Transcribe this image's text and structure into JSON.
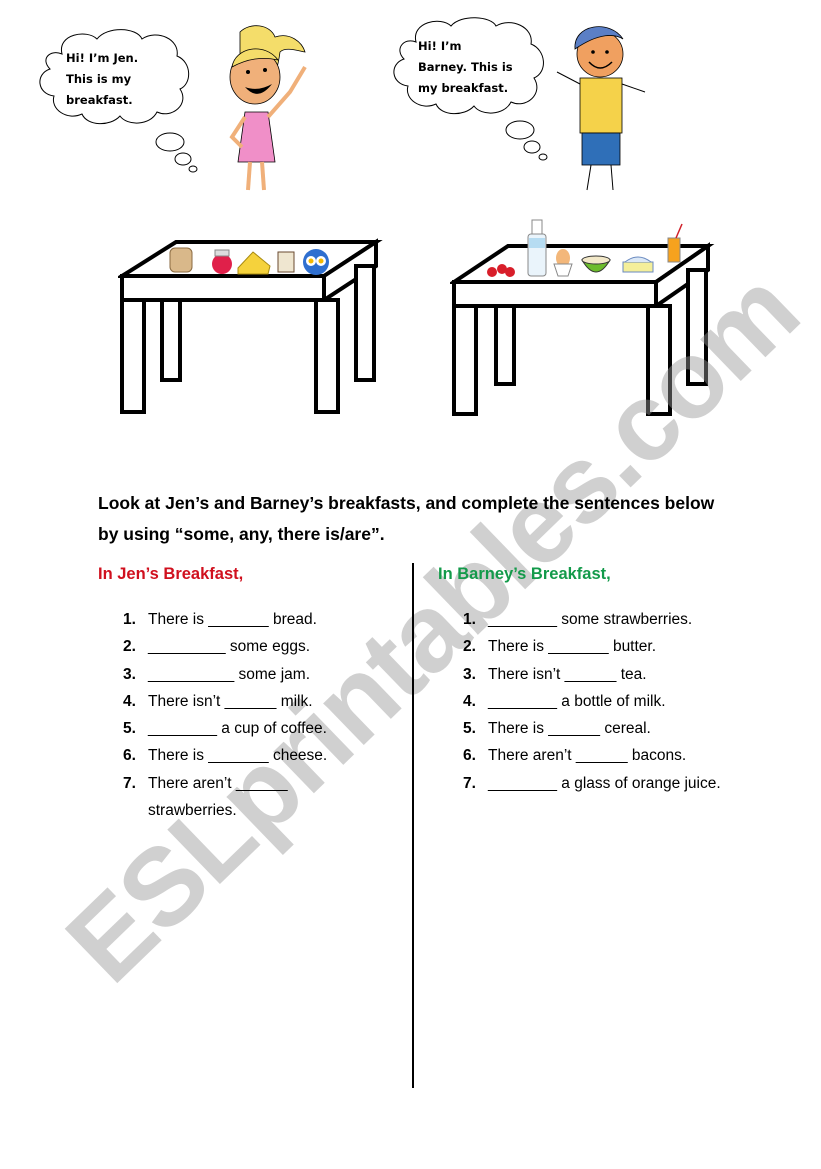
{
  "characters": {
    "jen": {
      "bubble_lines": [
        "Hi! I’m Jen.",
        "This is my",
        "breakfast."
      ],
      "colors": {
        "hair": "#f4dd6a",
        "dress": "#f08fc8",
        "skin": "#f0b07a"
      }
    },
    "barney": {
      "bubble_lines": [
        "Hi! I’m",
        "Barney. This is",
        "my breakfast."
      ],
      "colors": {
        "cap": "#5b7fc6",
        "shirt": "#f5d24a",
        "shorts": "#2f6fb8",
        "skin": "#f0a060"
      }
    }
  },
  "tables": {
    "jen_items": [
      "bread-icon",
      "jam-jar-icon",
      "cheese-icon",
      "coffee-mug-icon",
      "fried-eggs-plate-icon"
    ],
    "barney_items": [
      "strawberries-icon",
      "milk-bottle-icon",
      "boiled-egg-icon",
      "cereal-bowl-icon",
      "butter-dish-icon",
      "orange-juice-icon"
    ]
  },
  "instructions": "Look at Jen’s and Barney’s breakfasts, and complete the sentences below by using “some, any, there is/are”.",
  "jen": {
    "title": "In Jen’s Breakfast,",
    "title_color": "#d0101e",
    "items": [
      {
        "num": "1.",
        "text": "There is _______ bread."
      },
      {
        "num": "2.",
        "text": "_________ some eggs."
      },
      {
        "num": "3.",
        "text": "__________ some jam."
      },
      {
        "num": "4.",
        "text": "There isn’t ______ milk."
      },
      {
        "num": "5.",
        "text": "________ a cup of coffee."
      },
      {
        "num": "6.",
        "text": "There is _______ cheese."
      },
      {
        "num": "7.",
        "text": "There aren’t ______ strawberries."
      }
    ]
  },
  "barney": {
    "title": "In Barney’s Breakfast,",
    "title_color": "#139a4a",
    "items": [
      {
        "num": "1.",
        "text": "________ some strawberries."
      },
      {
        "num": "2.",
        "text": "There is _______ butter."
      },
      {
        "num": "3.",
        "text": "There isn’t ______ tea."
      },
      {
        "num": "4.",
        "text": "________ a bottle of milk."
      },
      {
        "num": "5.",
        "text": "There is ______ cereal."
      },
      {
        "num": "6.",
        "text": "There aren’t ______ bacons."
      },
      {
        "num": "7.",
        "text": "________ a glass of orange juice."
      }
    ]
  },
  "watermark": "ESLprintables.com"
}
